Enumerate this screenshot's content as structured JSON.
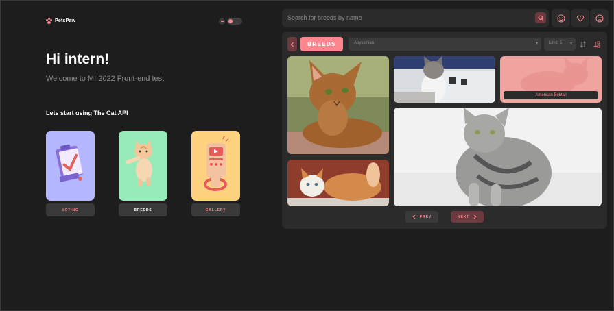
{
  "header": {
    "logo_text": "PetsPaw"
  },
  "greeting": {
    "title": "Hi intern!",
    "subtitle": "Welcome to MI 2022 Front-end test",
    "start_label": "Lets start using The Cat API"
  },
  "nav_cards": [
    {
      "label": "VOTING",
      "color": "#b4b7ff",
      "active": false
    },
    {
      "label": "BREEDS",
      "color": "#97eab9",
      "active": true
    },
    {
      "label": "GALLERY",
      "color": "#ffd280",
      "active": false
    }
  ],
  "search": {
    "placeholder": "Search for breeds by name"
  },
  "toolbar": {
    "breeds_tag": "BREEDS",
    "breed_select": "Abyssinian",
    "limit_select": "Limit: 5"
  },
  "grid": {
    "hover_label": "American Bobtail"
  },
  "pagination": {
    "prev": "PREV",
    "next": "NEXT"
  },
  "colors": {
    "accent": "#ff868e",
    "background": "#1d1d1d",
    "panel": "#2b2b2b"
  }
}
